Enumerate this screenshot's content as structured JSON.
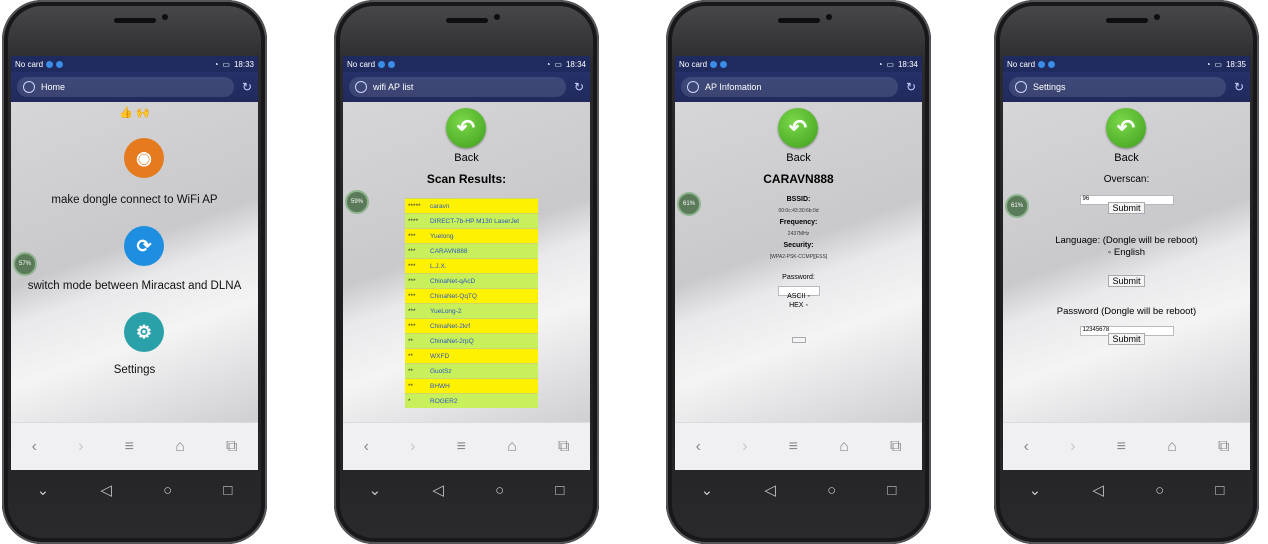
{
  "phones": [
    {
      "status": {
        "carrier": "No card",
        "time": "18:33"
      },
      "url_title": "Home",
      "home": {
        "emoji": "👍 🙌",
        "battery_badge": "57%",
        "items": [
          {
            "icon": "rss-icon",
            "label": "make dongle connect to WiFi AP",
            "color": "#e57a1f"
          },
          {
            "icon": "refresh-icon",
            "label": "switch mode between Miracast and DLNA",
            "color": "#1e8fe0"
          },
          {
            "icon": "gear-icon",
            "label": "Settings",
            "color": "#2aa0a8"
          }
        ]
      }
    },
    {
      "status": {
        "carrier": "No card",
        "time": "18:34"
      },
      "url_title": "wifi AP list",
      "back_label": "Back",
      "battery_badge": "59%",
      "scan_title": "Scan Results:",
      "scan_rows": [
        {
          "signal": "*****",
          "ssid": "caravn"
        },
        {
          "signal": "****",
          "ssid": "DIRECT-7b-HP M130 LaserJet"
        },
        {
          "signal": "***",
          "ssid": "Yuelong"
        },
        {
          "signal": "***",
          "ssid": "CARAVN888"
        },
        {
          "signal": "***",
          "ssid": "L.J.X."
        },
        {
          "signal": "***",
          "ssid": "ChinaNet-qAcD"
        },
        {
          "signal": "***",
          "ssid": "ChinaNet-QqTQ"
        },
        {
          "signal": "***",
          "ssid": "YueLong-2"
        },
        {
          "signal": "***",
          "ssid": "ChinaNet-2krf"
        },
        {
          "signal": "**",
          "ssid": "ChinaNet-2rpQ"
        },
        {
          "signal": "**",
          "ssid": "WXFD"
        },
        {
          "signal": "**",
          "ssid": "GuotSz"
        },
        {
          "signal": "**",
          "ssid": "BHWH"
        },
        {
          "signal": "*",
          "ssid": "ROGER2"
        }
      ]
    },
    {
      "status": {
        "carrier": "No card",
        "time": "18:34"
      },
      "url_title": "AP Infomation",
      "back_label": "Back",
      "battery_badge": "61%",
      "ap": {
        "ssid": "CARAVN888",
        "bssid_label": "BSSID:",
        "bssid_value": "00:0c:43:30:6b:0d",
        "freq_label": "Frequency:",
        "freq_value": "2437MHz",
        "sec_label": "Security:",
        "sec_value": "[WPA2-PSK-CCMP][ESS]",
        "pwd_label": "Password:",
        "ascii_label": "ASCII",
        "hex_label": "HEX"
      }
    },
    {
      "status": {
        "carrier": "No card",
        "time": "18:35"
      },
      "url_title": "Settings",
      "back_label": "Back",
      "battery_badge": "61%",
      "settings": {
        "overscan_label": "Overscan:",
        "overscan_value": "96",
        "submit": "Submit",
        "language_label": "Language: (Dongle will be reboot)",
        "language_option": "English",
        "password_label": "Password (Dongle will be reboot)",
        "password_value": "12345678"
      }
    }
  ]
}
